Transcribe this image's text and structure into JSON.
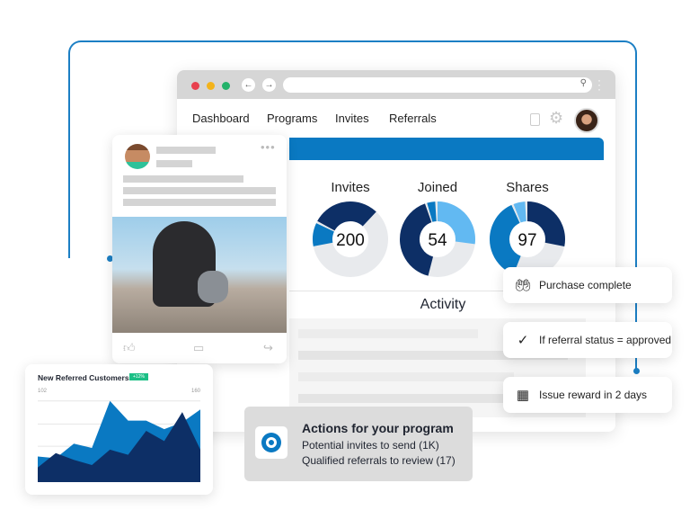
{
  "nav": {
    "items": [
      "Dashboard",
      "Programs",
      "Invites",
      "Referrals"
    ]
  },
  "icons": {
    "back": "arrow-left-icon",
    "forward": "arrow-right-icon",
    "search": "search-icon",
    "notebook": "notebook-icon",
    "settings": "gear-icon"
  },
  "colors": {
    "navy": "#0d2f66",
    "blue": "#0a79c2",
    "light_blue": "#62b9f2",
    "grey": "#e8eaed",
    "accent_green": "#1cbf86"
  },
  "stats": [
    {
      "label": "Invites",
      "value": "200",
      "segments": [
        {
          "color": "#0d2f66",
          "from": 0.83,
          "to": 1.12
        },
        {
          "color": "#0a79c2",
          "from": 0.72,
          "to": 0.82
        }
      ]
    },
    {
      "label": "Joined",
      "value": "54",
      "segments": [
        {
          "color": "#62b9f2",
          "from": 0.0,
          "to": 0.27
        },
        {
          "color": "#0a79c2",
          "from": 0.955,
          "to": 0.99
        },
        {
          "color": "#0d2f66",
          "from": 0.54,
          "to": 0.945
        }
      ]
    },
    {
      "label": "Shares",
      "value": "97",
      "segments": [
        {
          "color": "#0d2f66",
          "from": 0.0,
          "to": 0.28
        },
        {
          "color": "#0a79c2",
          "from": 0.56,
          "to": 0.93
        },
        {
          "color": "#62b9f2",
          "from": 0.94,
          "to": 0.99
        }
      ]
    }
  ],
  "activity_title": "Activity",
  "workflow": [
    {
      "icon": "hand-coin-icon",
      "text": "Purchase complete"
    },
    {
      "icon": "check-circle-icon",
      "text": "If referral status = approved"
    },
    {
      "icon": "calendar-icon",
      "text": "Issue reward in 2 days"
    }
  ],
  "actions": {
    "title": "Actions for your program",
    "lines": [
      "Potential invites to send (1K)",
      "Qualified referrals to review (17)"
    ]
  },
  "chart_data": {
    "type": "area",
    "title": "New Referred Customers",
    "badge": "+12%",
    "tick_labels": [
      "102",
      "160"
    ],
    "series": [
      {
        "color": "#0a79c2",
        "values": [
          30,
          28,
          45,
          40,
          95,
          72,
          72,
          62,
          70,
          85
        ]
      },
      {
        "color": "#0d2f66",
        "values": [
          17,
          34,
          26,
          20,
          38,
          32,
          60,
          48,
          82,
          38
        ]
      }
    ],
    "grid": true
  }
}
